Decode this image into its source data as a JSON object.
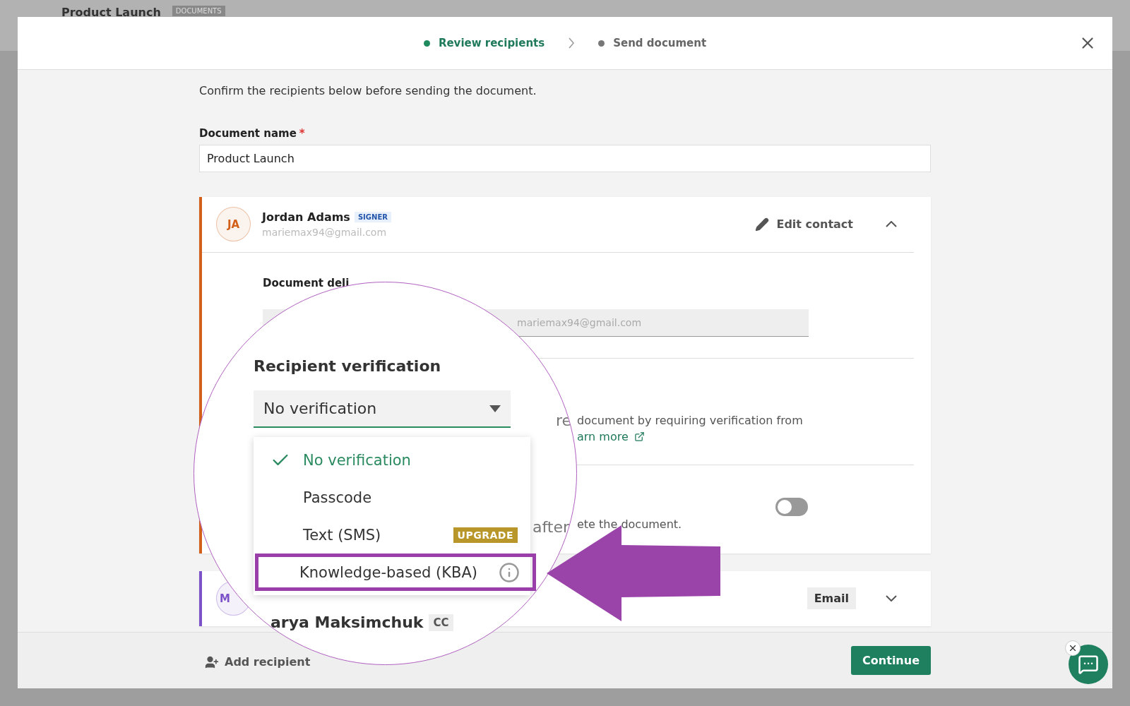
{
  "app_header": {
    "title": "Product Launch",
    "badge": "DOCUMENTS"
  },
  "steps": [
    {
      "label": "Review recipients",
      "selected": true
    },
    {
      "label": "Send document",
      "selected": false
    }
  ],
  "intro": "Confirm the recipients below before sending the document.",
  "document_name": {
    "label": "Document name",
    "required": true,
    "required_mark": "*",
    "value": "Product Launch"
  },
  "recipients": [
    {
      "initials": "JA",
      "name": "Jordan Adams",
      "role": "SIGNER",
      "email": "mariemax94@gmail.com",
      "color": "#d2601a",
      "expanded": true,
      "action": "Edit contact",
      "delivery_label": "Document deli",
      "delivery_email": "mariemax94@gmail.com",
      "verification_text": "document by requiring verification from",
      "learn_more": "arn more",
      "reminder_text": "ete the document.",
      "reminder_on": false
    },
    {
      "initials": "M",
      "color": "#7b52c8",
      "expanded": false,
      "delivery": "Email"
    }
  ],
  "magnifier": {
    "heading": "Recipient verification",
    "select_value": "No verification",
    "fragment_left": "re",
    "fragment_right": "after",
    "options": [
      {
        "label": "No verification",
        "selected": true,
        "highlighted": false,
        "kind": "plain"
      },
      {
        "label": "Passcode",
        "selected": false,
        "highlighted": false,
        "kind": "plain"
      },
      {
        "label": "Text (SMS)",
        "selected": false,
        "highlighted": false,
        "kind": "badge",
        "badge": "UPGRADE"
      },
      {
        "label": "Knowledge-based (KBA)",
        "selected": false,
        "highlighted": true,
        "kind": "info"
      }
    ],
    "next_name": "arya Maksimchuk",
    "next_role": "CC"
  },
  "footer": {
    "add": "Add recipient",
    "continue": "Continue"
  }
}
